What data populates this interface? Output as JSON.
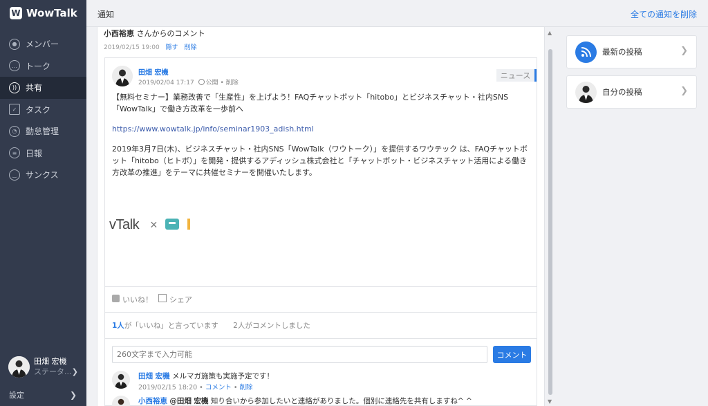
{
  "app": {
    "name": "WowTalk"
  },
  "sidebar": {
    "items": [
      {
        "label": "メンバー",
        "active": false
      },
      {
        "label": "トーク",
        "active": false
      },
      {
        "label": "共有",
        "active": true
      },
      {
        "label": "タスク",
        "active": false
      },
      {
        "label": "勤怠管理",
        "active": false
      },
      {
        "label": "日報",
        "active": false
      },
      {
        "label": "サンクス",
        "active": false
      }
    ],
    "user": {
      "name": "田畑 宏機",
      "status": "ステータ..."
    },
    "settings_label": "設定"
  },
  "header": {
    "title": "通知",
    "delete_all_label": "全ての通知を削除"
  },
  "notification": {
    "sender": "小西裕恵",
    "suffix": " さんからのコメント",
    "date": "2019/02/15 19:00",
    "hide_label": "隠す",
    "delete_label": "削除"
  },
  "post": {
    "author": "田畑 宏機",
    "date": "2019/02/04 17:17",
    "visibility": "公開",
    "delete_label": "削除",
    "tag": "ニュース",
    "paragraph1": "【無料セミナー】業務改善で「生産性」を上げよう！FAQチャットボット「hitobo」とビジネスチャット・社内SNS「WowTalk」で働き方改革を一歩前へ",
    "url": "https://www.wowtalk.jp/info/seminar1903_adish.html",
    "paragraph2": "2019年3月7日(木)、ビジネスチャット・社内SNS「WowTalk（ワウトーク）」を提供するワウテック は、FAQチャットボット「hitobo（ヒトボ）」を開発・提供するアディッシュ株式会社と「チャットボット・ビジネスチャット活用による働き方改革の推進」をテーマに共催セミナーを開催いたします。",
    "banner_text": "vTalk",
    "banner_times": "×",
    "like_label": "いいね！",
    "share_label": "シェア",
    "likes_count": "1人",
    "likes_text": "が「いいね」と言っています",
    "comments_text": "2人がコメントしました"
  },
  "comment_box": {
    "placeholder": "260文字まで入力可能",
    "submit_label": "コメント"
  },
  "comments": [
    {
      "author": "田畑 宏機",
      "text": "メルマガ施策も実施予定です！",
      "date": "2019/02/15 18:20",
      "reply_label": "コメント",
      "delete_label": "削除"
    },
    {
      "author": "小西裕恵",
      "mention": "@田畑 宏機",
      "text": "知り合いから参加したいと連絡がありました。個別に連絡先を共有しますね^ ^"
    }
  ],
  "right_panel": {
    "latest_posts_label": "最新の投稿",
    "my_posts_label": "自分の投稿"
  },
  "colors": {
    "sidebar": "#333b4d",
    "accent": "#2a7be4"
  }
}
